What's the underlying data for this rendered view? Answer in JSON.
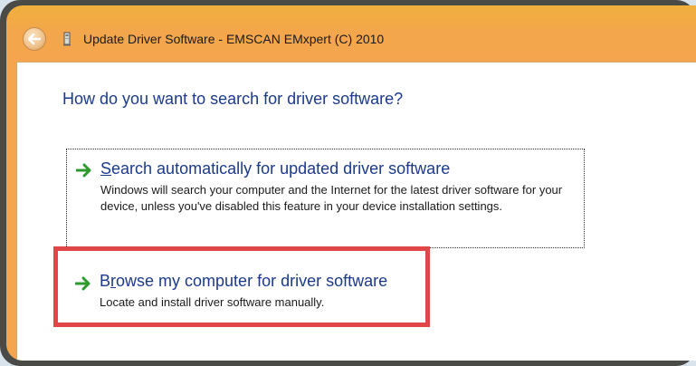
{
  "window": {
    "title": "Update Driver Software - EMSCAN EMxpert (C) 2010"
  },
  "main": {
    "heading": "How do you want to search for driver software?",
    "options": [
      {
        "title": "Search automatically for updated driver software",
        "accelerator": "S",
        "description": "Windows will search your computer and the Internet for the latest driver software for your device, unless you've disabled this feature in your device installation settings."
      },
      {
        "title": "Browse my computer for driver software",
        "accelerator": "r",
        "description": "Locate and install driver software manually."
      }
    ]
  },
  "colors": {
    "title_bar": "#f4a54e",
    "link_text": "#1c3a8c",
    "arrow_green": "#2c9a2c",
    "highlight_box": "#e04646"
  },
  "icons": {
    "back": "back-arrow-icon",
    "device": "device-icon",
    "option_arrow": "green-arrow-icon"
  }
}
